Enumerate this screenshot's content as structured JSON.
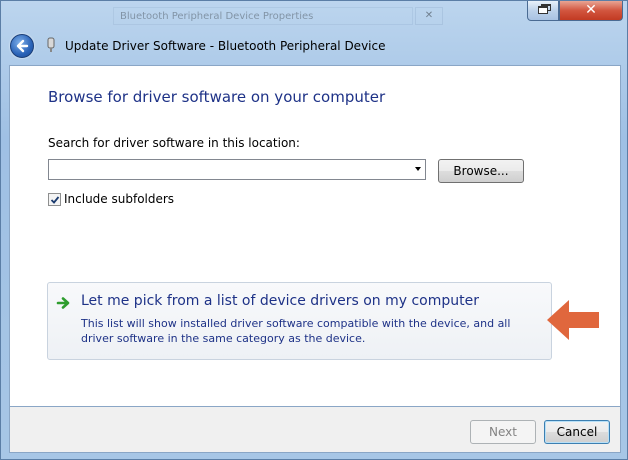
{
  "background_window": {
    "title": "Bluetooth Peripheral Device Properties",
    "close_label": "✕"
  },
  "titlebar": {
    "title": "Update Driver Software - Bluetooth Peripheral Device",
    "close_label": "✕"
  },
  "main": {
    "heading": "Browse for driver software on your computer",
    "search_label": "Search for driver software in this location:",
    "search_value": "",
    "browse_label": "Browse...",
    "include_subfolders_label": "Include subfolders",
    "include_subfolders_checked": true,
    "pick_option": {
      "title": "Let me pick from a list of device drivers on my computer",
      "description": "This list will show installed driver software compatible with the device, and all driver software in the same category as the device."
    }
  },
  "footer": {
    "next_label": "Next",
    "cancel_label": "Cancel"
  },
  "colors": {
    "link_blue": "#1e3287",
    "annotation_arrow": "#e0673d",
    "close_red": "#c23a22"
  }
}
